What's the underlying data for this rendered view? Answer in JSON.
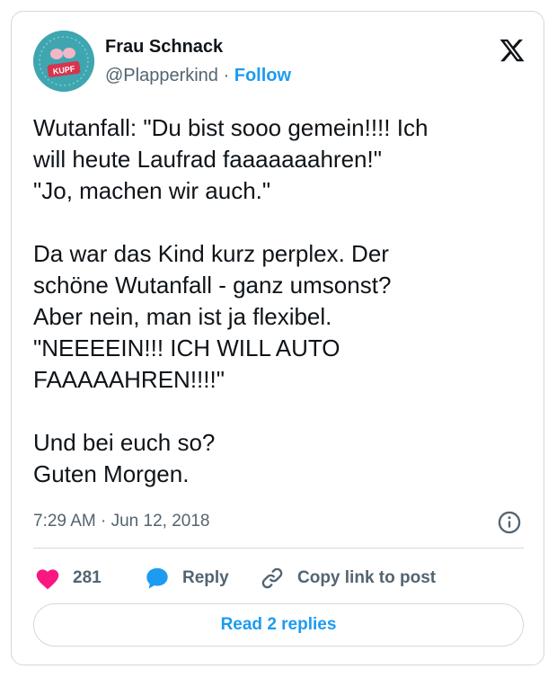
{
  "author": {
    "name": "Frau Schnack",
    "handle": "@Plapperkind",
    "separator": "·",
    "follow_label": "Follow",
    "avatar_text": "KUPF"
  },
  "tweet": {
    "text": "Wutanfall: \"Du bist sooo gemein!!!! Ich\nwill heute Laufrad faaaaaaahren!\"\n\"Jo, machen wir auch.\"\n\nDa war das Kind kurz perplex. Der\nschöne Wutanfall - ganz umsonst?\nAber nein, man ist ja flexibel.\n\"NEEEEIN!!! ICH WILL AUTO\nFAAAAAHREN!!!!\"\n\nUnd bei euch so?\nGuten Morgen.",
    "time": "7:29 AM",
    "date": "Jun 12, 2018"
  },
  "actions": {
    "like_count": "281",
    "reply_label": "Reply",
    "copy_label": "Copy link to post"
  },
  "footer": {
    "read_replies_label": "Read 2 replies"
  },
  "icons": {
    "like": "heart-icon",
    "reply": "speech-bubble-icon",
    "copy": "link-icon",
    "info": "info-icon",
    "brand": "x-logo-icon"
  },
  "colors": {
    "accent": "#1d9bf0",
    "like": "#f91880",
    "muted": "#536471",
    "border": "#cfd9de"
  }
}
